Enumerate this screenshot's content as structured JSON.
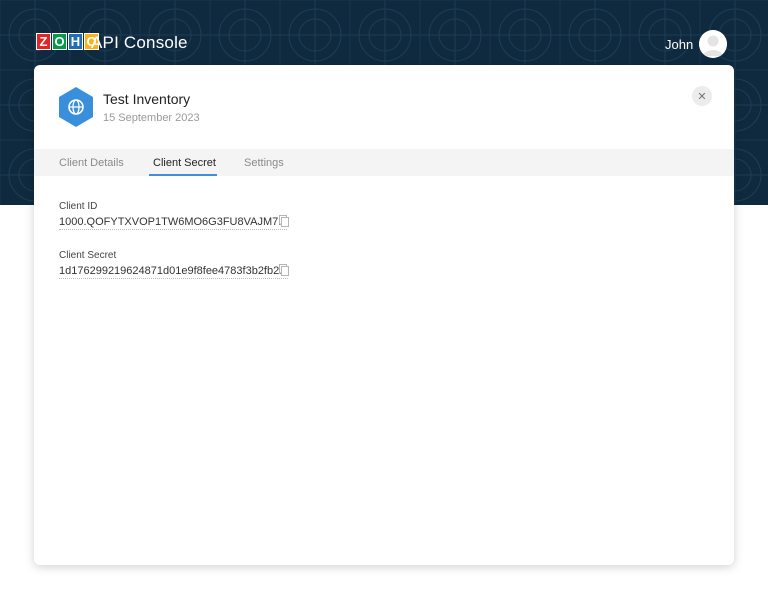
{
  "header": {
    "logo_letters": [
      "Z",
      "O",
      "H",
      "O"
    ],
    "logo_colors": [
      "#e42527",
      "#089949",
      "#226db4",
      "#f9b21d"
    ],
    "console_title": "API Console",
    "user_name": "John"
  },
  "client": {
    "name": "Test Inventory",
    "date": "15 September 2023",
    "icon": "globe-icon",
    "icon_color": "#3a8fdd"
  },
  "tabs": [
    {
      "label": "Client Details",
      "active": false
    },
    {
      "label": "Client Secret",
      "active": true
    },
    {
      "label": "Settings",
      "active": false
    }
  ],
  "fields": [
    {
      "label": "Client ID",
      "value": "1000.QOFYTXVOP1TW6MO6G3FU8VAJM7..."
    },
    {
      "label": "Client Secret",
      "value": "1d176299219624871d01e9f8fee4783f3b2fb2..."
    }
  ],
  "colors": {
    "hero_bg": "#0f2a3f",
    "tab_active_underline": "#3f8edc"
  }
}
